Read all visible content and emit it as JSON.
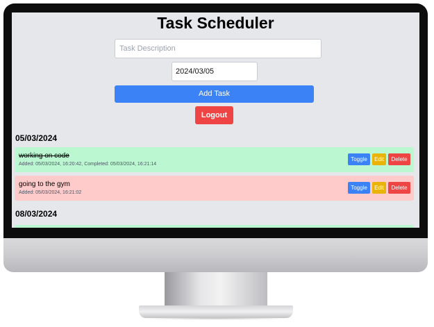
{
  "app": {
    "title": "Task Scheduler"
  },
  "form": {
    "description_placeholder": "Task Description",
    "description_value": "",
    "date_value": "2024/03/05",
    "add_label": "Add Task",
    "logout_label": "Logout"
  },
  "groups": [
    {
      "date": "05/03/2024",
      "tasks": [
        {
          "name": "working on code",
          "meta": "Added: 05/03/2024, 16:20:42, Completed: 05/03/2024, 16:21:14",
          "status": "completed",
          "color": "#bbf7d0"
        },
        {
          "name": "going to the gym",
          "meta": "Added: 05/03/2024, 16:21:02",
          "status": "pending",
          "color": "#fecaca"
        }
      ]
    },
    {
      "date": "08/03/2024",
      "tasks": []
    }
  ],
  "task_actions": {
    "toggle_label": "Toggle",
    "edit_label": "Edit",
    "delete_label": "Delete"
  },
  "colors": {
    "accent_blue": "#3b82f6",
    "danger_red": "#ef4444",
    "edit_yellow": "#eab308",
    "screen_bg": "#e5e7eb"
  }
}
